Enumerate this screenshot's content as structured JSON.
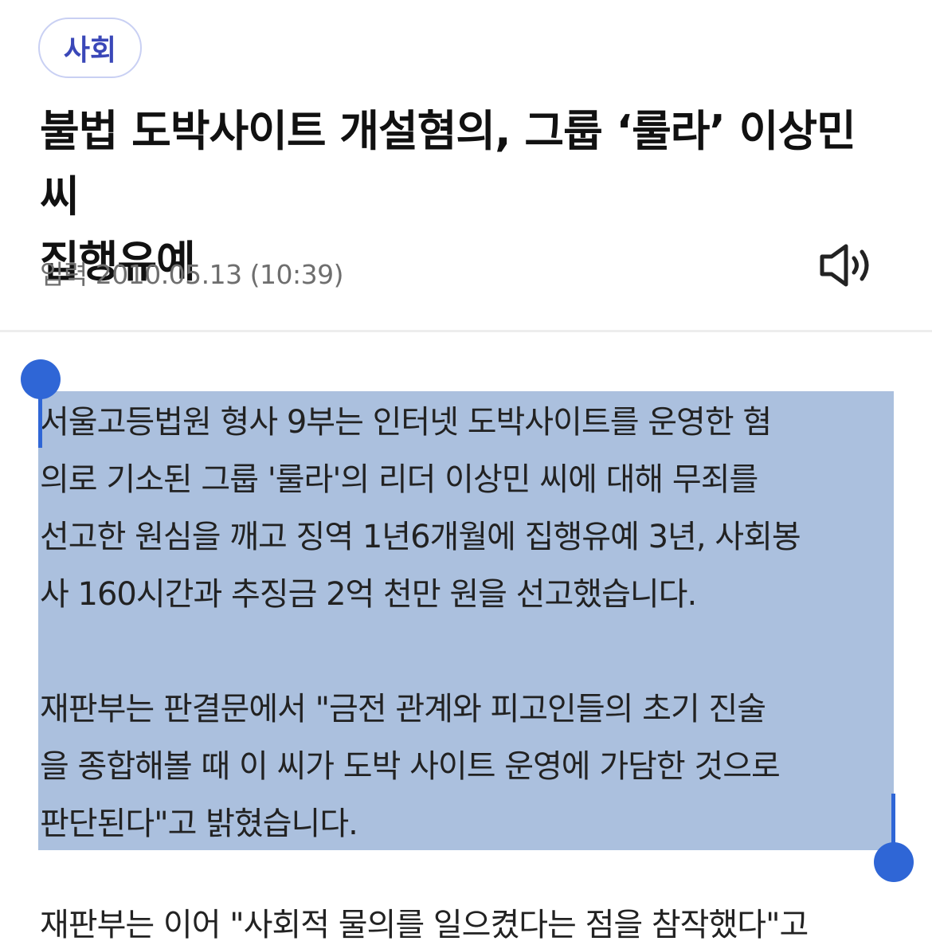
{
  "category": "사회",
  "headline": {
    "line1": "불법 도박사이트 개설혐의, 그룹 ‘룰라’ 이상민 씨",
    "line2": "집행유예"
  },
  "published": "입력 2010.05.13 (10:39)",
  "icons": {
    "tts": "speaker-volume-icon"
  },
  "colors": {
    "selection": "#abc0de",
    "handle": "#2f66d6",
    "badge_text": "#3a47b8",
    "badge_border": "#c9d0f3"
  },
  "article": {
    "paragraph1": [
      "서울고등법원 형사 9부는 인터넷 도박사이트를 운영한 혐",
      "의로 기소된 그룹 '룰라'의 리더 이상민 씨에 대해 무죄를",
      "선고한 원심을 깨고 징역 1년6개월에 집행유예 3년, 사회봉",
      "사 160시간과 추징금 2억 천만 원을 선고했습니다."
    ],
    "paragraph2": [
      "재판부는 판결문에서 \"금전 관계와 피고인들의 초기 진술",
      "을 종합해볼 때 이 씨가 도박 사이트 운영에 가담한 것으로",
      "판단된다\"고 밝혔습니다."
    ],
    "next_line_partial": "재판부는 이어 \"사회적 물의를 일으켰다는 점을 참작했다\"고"
  }
}
